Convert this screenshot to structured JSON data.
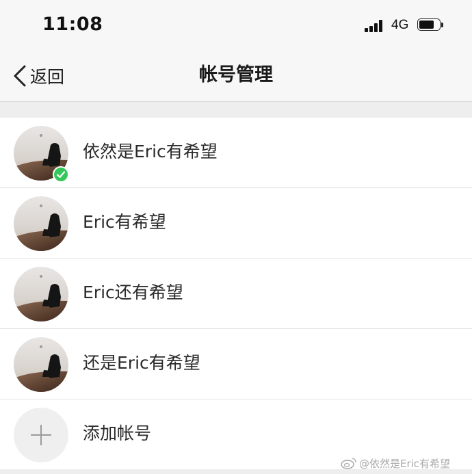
{
  "status_bar": {
    "time": "11:08",
    "network": "4G",
    "signal_bars": 4,
    "battery_level": 0.7
  },
  "nav": {
    "back_label": "返回",
    "title": "帐号管理"
  },
  "accounts": [
    {
      "name": "依然是Eric有希望",
      "active": true
    },
    {
      "name": "Eric有希望",
      "active": false
    },
    {
      "name": "Eric还有希望",
      "active": false
    },
    {
      "name": "还是Eric有希望",
      "active": false
    }
  ],
  "add_account": {
    "label": "添加帐号"
  },
  "watermark": {
    "text": "@依然是Eric有希望"
  },
  "colors": {
    "check_green": "#34c759",
    "nav_background": "#f7f7f7",
    "section_gap": "#eeeeee"
  },
  "icons": {
    "back": "chevron-left-icon",
    "check": "check-badge-icon",
    "add": "plus-icon",
    "watermark": "weibo-icon"
  }
}
